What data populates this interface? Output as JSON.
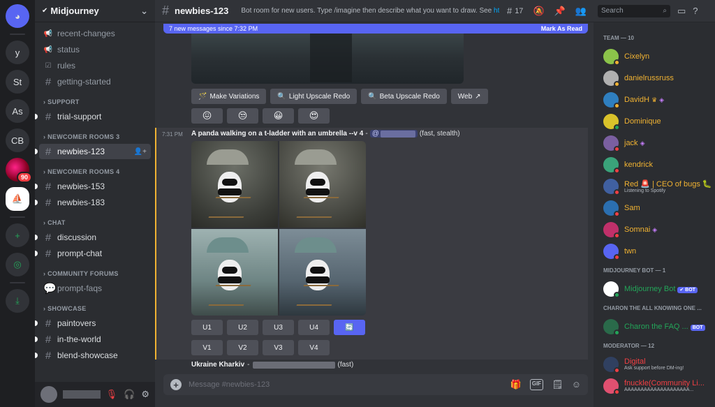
{
  "rail": {
    "servers": [
      {
        "label": "",
        "kind": "home"
      },
      {
        "label": "y"
      },
      {
        "label": "St"
      },
      {
        "label": "As"
      },
      {
        "label": "CB"
      },
      {
        "label": "",
        "badge": "90"
      },
      {
        "label": "",
        "kind": "selected"
      }
    ],
    "add_label": "+",
    "explore_label": "◎",
    "download_label": "⤓"
  },
  "sidebar": {
    "guild_name": "Midjourney",
    "channels_top": [
      {
        "name": "recent-changes",
        "icon": "megaphone-icon"
      },
      {
        "name": "status",
        "icon": "megaphone-icon"
      },
      {
        "name": "rules",
        "icon": "checkbox-icon"
      },
      {
        "name": "getting-started",
        "icon": "hash-icon"
      }
    ],
    "categories": [
      {
        "name": "SUPPORT",
        "channels": [
          "trial-support"
        ]
      },
      {
        "name": "NEWCOMER ROOMS 3",
        "channels": [
          "newbies-123"
        ]
      },
      {
        "name": "NEWCOMER ROOMS 4",
        "channels": [
          "newbies-153",
          "newbies-183"
        ]
      },
      {
        "name": "CHAT",
        "channels": [
          "discussion",
          "prompt-chat"
        ]
      },
      {
        "name": "COMMUNITY FORUMS",
        "channels": [
          "prompt-faqs"
        ]
      },
      {
        "name": "SHOWCASE",
        "channels": [
          "paintovers",
          "in-the-world",
          "blend-showcase"
        ]
      }
    ]
  },
  "header": {
    "channel": "newbies-123",
    "topic": "Bot room for new users. Type /imagine then describe what you want to draw. See",
    "topic_link": "https:",
    "thread_count": "17",
    "search_placeholder": "Search"
  },
  "new_messages": {
    "text": "7 new messages since 7:32 PM",
    "action": "Mark As Read"
  },
  "upscale_buttons": [
    {
      "icon": "🪄",
      "label": "Make Variations"
    },
    {
      "icon": "🔍",
      "label": "Light Upscale Redo"
    },
    {
      "icon": "🔍",
      "label": "Beta Upscale Redo"
    },
    {
      "icon": "",
      "label": "Web",
      "suffix": "↗"
    }
  ],
  "reactions": [
    "😖",
    "😒",
    "😀",
    "😍"
  ],
  "message": {
    "time": "7:31 PM",
    "prompt": "A panda walking on a t-ladder with an umbrella --v 4",
    "dash": "-",
    "mention_at": "@",
    "suffix": "(fast, stealth)",
    "images": [
      "panda-1",
      "panda-2",
      "panda-3",
      "panda-4"
    ]
  },
  "upscale_row": [
    "U1",
    "U2",
    "U3",
    "U4"
  ],
  "refresh_label": "🔄",
  "variation_row": [
    "V1",
    "V2",
    "V3",
    "V4"
  ],
  "next_message": {
    "prompt": "Ukraine Kharkiv",
    "dash": "-",
    "suffix": "(fast)"
  },
  "composer": {
    "placeholder": "Message #newbies-123",
    "gif_label": "GIF"
  },
  "members": {
    "groups": [
      {
        "title": "TEAM — 10",
        "items": [
          {
            "name": "Cixelyn",
            "color": "#f0b232",
            "avatar": "#8bc34a",
            "status": "idle"
          },
          {
            "name": "danielrussruss",
            "color": "#f0b232",
            "avatar": "#b0b0b0",
            "status": "idle"
          },
          {
            "name": "DavidH",
            "color": "#f0b232",
            "avatar": "#2f7fbf",
            "status": "idle",
            "crown": "♛",
            "gem": "◈"
          },
          {
            "name": "Dominique",
            "color": "#f0b232",
            "avatar": "#d9c22a",
            "status": "on"
          },
          {
            "name": "jack",
            "color": "#f0b232",
            "avatar": "#7a5fa0",
            "status": "dnd",
            "gem": "◈"
          },
          {
            "name": "kendrick",
            "color": "#f0b232",
            "avatar": "#3aa37a",
            "status": "dnd"
          },
          {
            "name": "Red 🚨 | CEO of bugs 🐛",
            "color": "#f0b232",
            "avatar": "#4060a0",
            "status": "dnd",
            "sub": "Listening to Spotify"
          },
          {
            "name": "Sam",
            "color": "#f0b232",
            "avatar": "#2b6fb0",
            "status": "dnd"
          },
          {
            "name": "Somnai",
            "color": "#f0b232",
            "avatar": "#c0306a",
            "status": "dnd",
            "gem": "◈"
          },
          {
            "name": "twn",
            "color": "#f0b232",
            "avatar": "#5865f2",
            "status": "dnd"
          }
        ]
      },
      {
        "title": "MIDJOURNEY BOT — 1",
        "items": [
          {
            "name": "Midjourney Bot",
            "color": "#23a559",
            "avatar": "#ffffff",
            "status": "on",
            "tag": "✔ BOT"
          }
        ]
      },
      {
        "title": "CHARON THE ALL KNOWING ONE ...",
        "items": [
          {
            "name": "Charon the FAQ ...",
            "color": "#23a559",
            "avatar": "#2a6a4a",
            "status": "on",
            "tag": "BOT"
          }
        ]
      },
      {
        "title": "MODERATOR — 12",
        "items": [
          {
            "name": "Digital",
            "color": "#f23f43",
            "avatar": "#304060",
            "status": "dnd",
            "sub": "Ask support before DM-ing!"
          },
          {
            "name": "fnuckle(Community Li...",
            "color": "#f23f43",
            "avatar": "#e05070",
            "status": "dnd",
            "sub": "AAAAAAAAAAAAAAAAAAAA..."
          }
        ]
      }
    ]
  }
}
